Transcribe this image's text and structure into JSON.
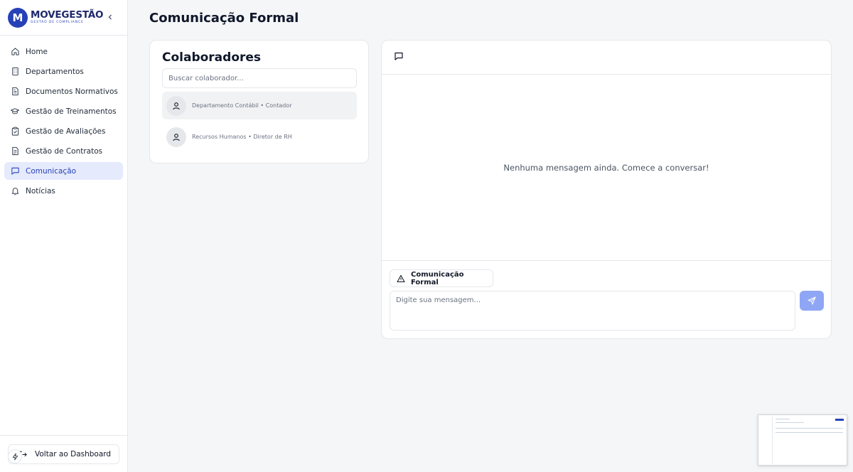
{
  "brand": {
    "name": "MOVEGESTÃO",
    "tagline": "GESTÃO DE COMPLIANCE",
    "initial": "M",
    "color": "#2741b6"
  },
  "sidebar": {
    "items": [
      {
        "label": "Home",
        "icon": "home-icon",
        "active": false
      },
      {
        "label": "Departamentos",
        "icon": "building-icon",
        "active": false
      },
      {
        "label": "Documentos Normativos",
        "icon": "document-icon",
        "active": false
      },
      {
        "label": "Gestão de Treinamentos",
        "icon": "graduation-cap-icon",
        "active": false
      },
      {
        "label": "Gestão de Avaliações",
        "icon": "clipboard-check-icon",
        "active": false
      },
      {
        "label": "Gestão de Contratos",
        "icon": "contract-icon",
        "active": false
      },
      {
        "label": "Comunicação",
        "icon": "message-square-icon",
        "active": true
      },
      {
        "label": "Notícias",
        "icon": "bell-icon",
        "active": false
      }
    ],
    "back_label": "Voltar ao Dashboard"
  },
  "page": {
    "title": "Comunicação Formal"
  },
  "colaboradores": {
    "title": "Colaboradores",
    "search_placeholder": "Buscar colaborador...",
    "contacts": [
      {
        "label": "Departamento Contábil • Contador",
        "selected": true
      },
      {
        "label": "Recursos Humanos • Diretor de RH",
        "selected": false
      }
    ]
  },
  "chat": {
    "empty_message": "Nenhuma mensagem ainda. Comece a conversar!",
    "formal_label": "Comunicação Formal",
    "message_placeholder": "Digite sua mensagem...",
    "send_color": "#8fa6f5"
  }
}
